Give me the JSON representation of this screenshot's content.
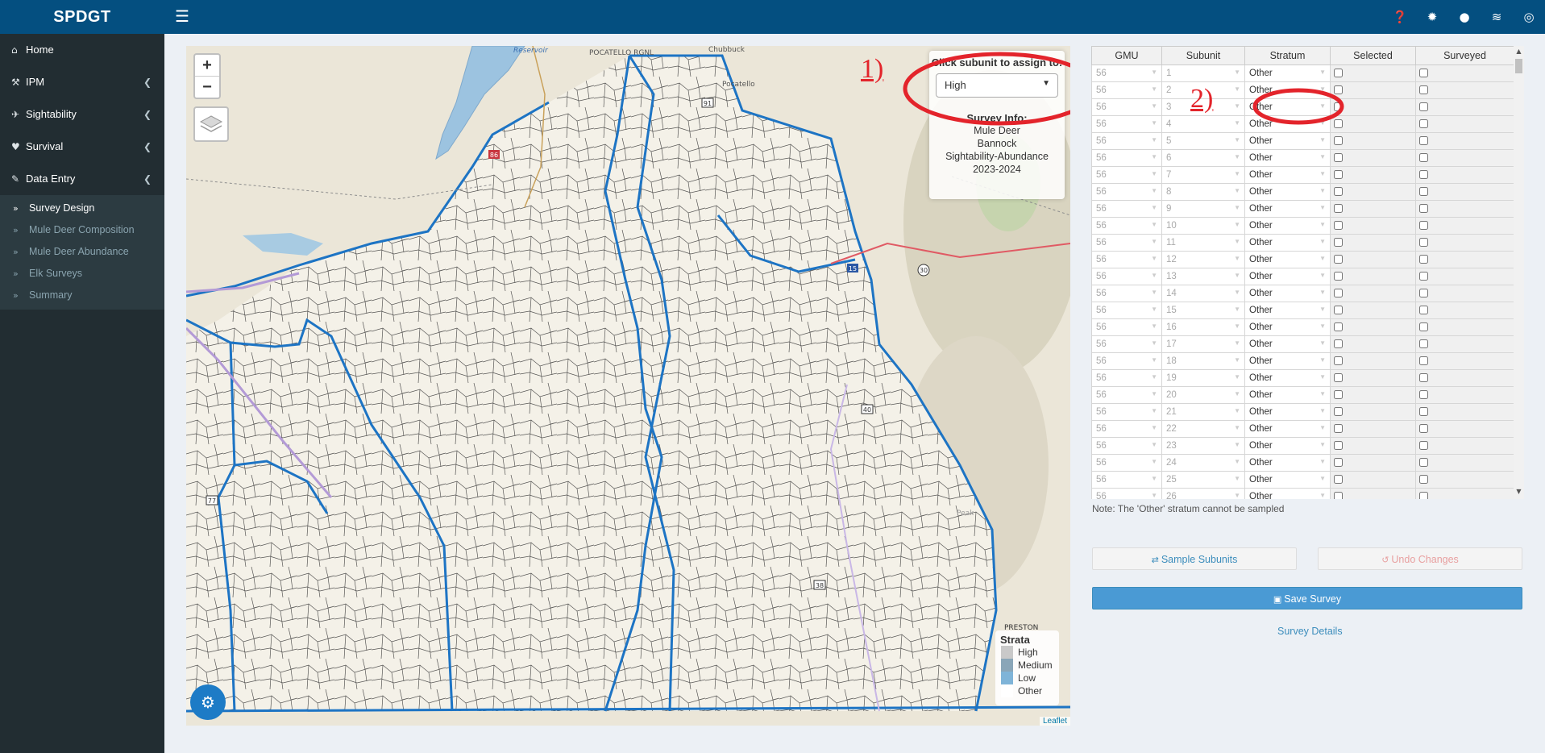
{
  "brand": "SPDGT",
  "header_icons": [
    "question-circle-icon",
    "bug-icon",
    "lightbulb-icon",
    "rss-icon",
    "globe-icon"
  ],
  "sidebar": {
    "items": [
      {
        "label": "Home",
        "icon": "home-icon"
      },
      {
        "label": "IPM",
        "icon": "wrench-icon"
      },
      {
        "label": "Sightability",
        "icon": "plane-icon"
      },
      {
        "label": "Survival",
        "icon": "heartbeat-icon"
      },
      {
        "label": "Data Entry",
        "icon": "pencil-icon"
      }
    ],
    "data_entry_subitems": [
      {
        "label": "Survey Design",
        "active": true
      },
      {
        "label": "Mule Deer Composition",
        "active": false
      },
      {
        "label": "Mule Deer Abundance",
        "active": false
      },
      {
        "label": "Elk Surveys",
        "active": false
      },
      {
        "label": "Summary",
        "active": false
      }
    ]
  },
  "map": {
    "zoom_in": "+",
    "zoom_out": "−",
    "assign_label": "Click subunit to assign to:",
    "assign_value": "High",
    "survey_info_title": "Survey Info:",
    "survey_info_lines": [
      "Mule Deer",
      "Bannock",
      "Sightability-Abundance",
      "2023-2024"
    ],
    "place_labels": [
      "Reservoir",
      "POCATELLO RGNL",
      "Chubbuck",
      "Pocatello",
      "Peak",
      "PRESTON"
    ],
    "route_shields": [
      "86",
      "15",
      "30",
      "91",
      "40",
      "38",
      "77"
    ],
    "legend_title": "Strata",
    "legend": [
      {
        "label": "High",
        "color": "#c9c9c9"
      },
      {
        "label": "Medium",
        "color": "#8aa6b8"
      },
      {
        "label": "Low",
        "color": "#7fb4d8"
      },
      {
        "label": "Other",
        "color": "#ffffff"
      }
    ],
    "attribution": "Leaflet"
  },
  "annotations": {
    "one": "1)",
    "two": "2)"
  },
  "table": {
    "columns": [
      "GMU",
      "Subunit",
      "Stratum",
      "Selected",
      "Surveyed"
    ],
    "rows": [
      [
        "56",
        "1",
        "Other"
      ],
      [
        "56",
        "2",
        "Other"
      ],
      [
        "56",
        "3",
        "Other"
      ],
      [
        "56",
        "4",
        "Other"
      ],
      [
        "56",
        "5",
        "Other"
      ],
      [
        "56",
        "6",
        "Other"
      ],
      [
        "56",
        "7",
        "Other"
      ],
      [
        "56",
        "8",
        "Other"
      ],
      [
        "56",
        "9",
        "Other"
      ],
      [
        "56",
        "10",
        "Other"
      ],
      [
        "56",
        "11",
        "Other"
      ],
      [
        "56",
        "12",
        "Other"
      ],
      [
        "56",
        "13",
        "Other"
      ],
      [
        "56",
        "14",
        "Other"
      ],
      [
        "56",
        "15",
        "Other"
      ],
      [
        "56",
        "16",
        "Other"
      ],
      [
        "56",
        "17",
        "Other"
      ],
      [
        "56",
        "18",
        "Other"
      ],
      [
        "56",
        "19",
        "Other"
      ],
      [
        "56",
        "20",
        "Other"
      ],
      [
        "56",
        "21",
        "Other"
      ],
      [
        "56",
        "22",
        "Other"
      ],
      [
        "56",
        "23",
        "Other"
      ],
      [
        "56",
        "24",
        "Other"
      ],
      [
        "56",
        "25",
        "Other"
      ],
      [
        "56",
        "26",
        "Other"
      ]
    ],
    "note": "Note: The 'Other' stratum cannot be sampled"
  },
  "buttons": {
    "sample": "Sample Subunits",
    "undo": "Undo Changes",
    "save": "Save Survey",
    "details": "Survey Details"
  },
  "colors": {
    "header": "#044f80",
    "sidebar": "#222d32",
    "accent": "#3c8dbc",
    "annotation": "#e3242b"
  }
}
